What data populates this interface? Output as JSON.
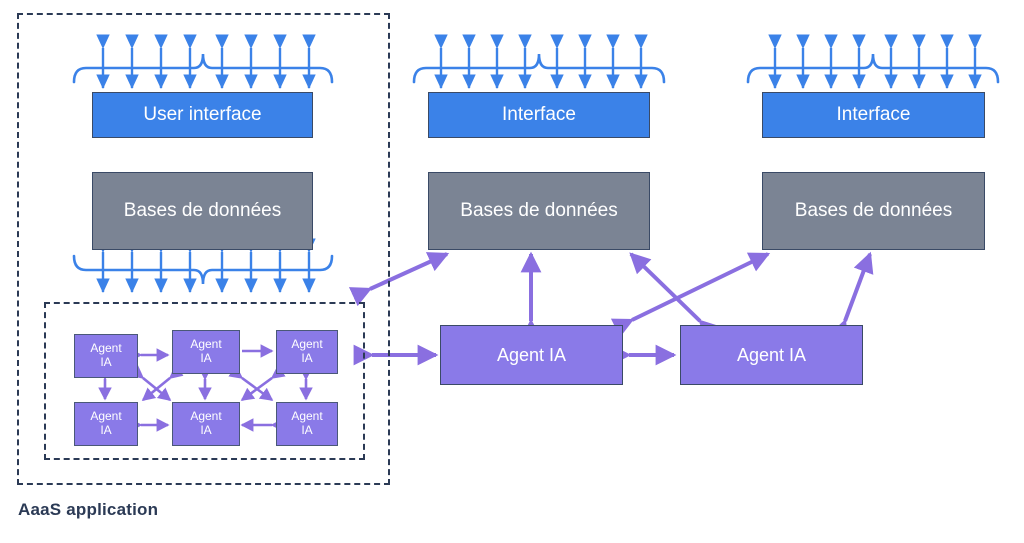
{
  "diagram": {
    "title_caption": "AaaS application",
    "colors": {
      "blue": "#3b82e8",
      "gray": "#7b8494",
      "purple": "#8a7ae8",
      "arrow_blue": "#3b82e8",
      "arrow_purple": "#8a6fe0",
      "dashed_border": "#2b3a55",
      "box_border": "#3a4a66",
      "text_light": "#ffffff",
      "caption_text": "#2b3a55"
    },
    "columns": [
      {
        "id": "aaas-application",
        "interface_label": "User interface",
        "database_label": "Bases de données",
        "has_top_brace": true,
        "has_bottom_brace": true,
        "agent_grid": {
          "rows": 2,
          "cols": 3,
          "cells": [
            "Agent IA",
            "Agent IA",
            "Agent IA",
            "Agent IA",
            "Agent IA",
            "Agent IA"
          ]
        }
      },
      {
        "id": "column-middle",
        "interface_label": "Interface",
        "database_label": "Bases de données",
        "has_top_brace": true,
        "agent_label": "Agent IA"
      },
      {
        "id": "column-right",
        "interface_label": "Interface",
        "database_label": "Bases de données",
        "has_top_brace": true,
        "agent_label": "Agent IA"
      }
    ],
    "agent_grid_labels": {
      "r0c0": "Agent IA",
      "r0c1": "Agent IA",
      "r0c2": "Agent IA",
      "r1c0": "Agent IA",
      "r1c1": "Agent IA",
      "r1c2": "Agent IA"
    },
    "agent_line1": "Agent",
    "agent_line2": "IA"
  }
}
